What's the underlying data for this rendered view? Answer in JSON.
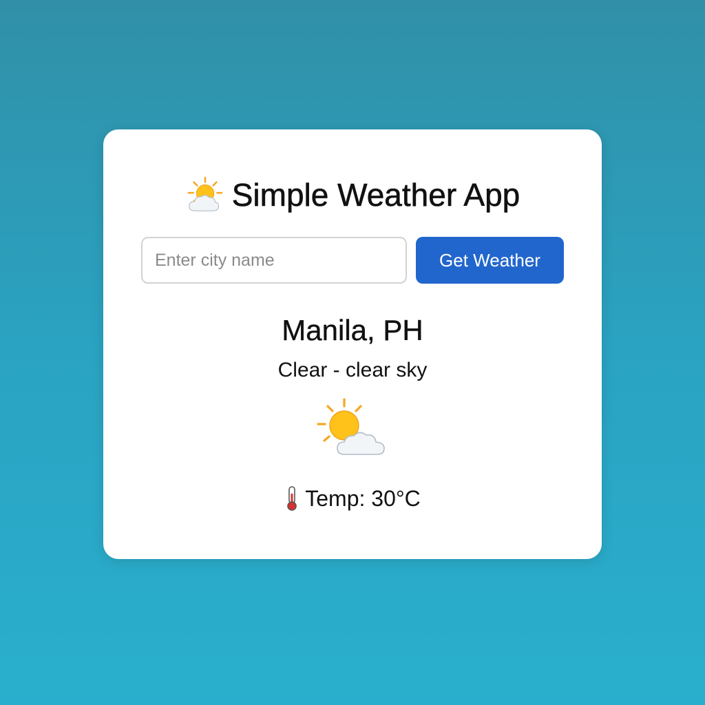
{
  "app": {
    "title": "Simple Weather App",
    "title_icon": "sun-behind-cloud-icon"
  },
  "search": {
    "placeholder": "Enter city name",
    "value": "",
    "button_label": "Get Weather"
  },
  "weather": {
    "location": "Manila, PH",
    "condition": "Clear - clear sky",
    "condition_icon": "sun-behind-cloud-icon",
    "temp_label": "Temp: 30°C",
    "temp_icon": "thermometer-icon"
  },
  "colors": {
    "background_top": "#3190a8",
    "background_bottom": "#29afcd",
    "card": "#ffffff",
    "button": "#2166cc",
    "button_text": "#ffffff"
  }
}
